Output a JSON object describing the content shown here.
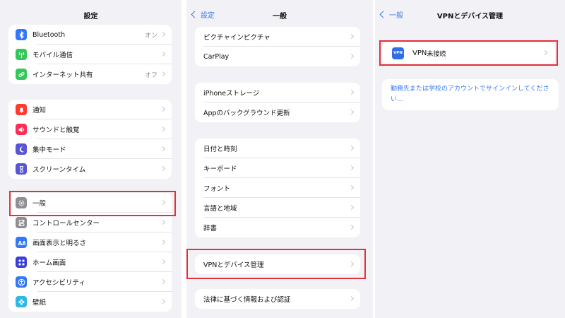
{
  "panel1": {
    "title": "設定",
    "groups": [
      [
        {
          "label": "Bluetooth",
          "value": "オン",
          "icon": "bluetooth-icon",
          "color": "#3478f6"
        },
        {
          "label": "モバイル通信",
          "value": "",
          "icon": "antenna-icon",
          "color": "#34c759"
        },
        {
          "label": "インターネット共有",
          "value": "オフ",
          "icon": "link-icon",
          "color": "#34c759"
        }
      ],
      [
        {
          "label": "通知",
          "value": "",
          "icon": "bell-icon",
          "color": "#ff3b30"
        },
        {
          "label": "サウンドと触覚",
          "value": "",
          "icon": "speaker-icon",
          "color": "#ff2d55"
        },
        {
          "label": "集中モード",
          "value": "",
          "icon": "moon-icon",
          "color": "#5856d6"
        },
        {
          "label": "スクリーンタイム",
          "value": "",
          "icon": "hourglass-icon",
          "color": "#5856d6"
        }
      ],
      [
        {
          "label": "一般",
          "value": "",
          "icon": "gear-icon",
          "color": "#8e8e93"
        },
        {
          "label": "コントロールセンター",
          "value": "",
          "icon": "switches-icon",
          "color": "#8e8e93"
        },
        {
          "label": "画面表示と明るさ",
          "value": "",
          "icon": "text-size-icon",
          "color": "#3478f6"
        },
        {
          "label": "ホーム画面",
          "value": "",
          "icon": "grid-icon",
          "color": "#3a3fd9"
        },
        {
          "label": "アクセシビリティ",
          "value": "",
          "icon": "accessibility-icon",
          "color": "#3478f6"
        },
        {
          "label": "壁紙",
          "value": "",
          "icon": "flower-icon",
          "color": "#2fb7e8"
        }
      ]
    ]
  },
  "panel2": {
    "back": "設定",
    "title": "一般",
    "groups": [
      [
        "ピクチャインピクチャ",
        "CarPlay"
      ],
      [
        "iPhoneストレージ",
        "Appのバックグラウンド更新"
      ],
      [
        "日付と時刻",
        "キーボード",
        "フォント",
        "言語と地域",
        "辞書"
      ],
      [
        "VPNとデバイス管理"
      ],
      [
        "法律に基づく情報および認証"
      ]
    ]
  },
  "panel3": {
    "back": "一般",
    "title": "VPNとデバイス管理",
    "vpn_badge": "VPN",
    "vpn_label": "VPN",
    "vpn_status": "未接続",
    "signin_text": "勤務先または学校のアカウントでサインインしてください..."
  },
  "highlight_color": "#e0323a"
}
